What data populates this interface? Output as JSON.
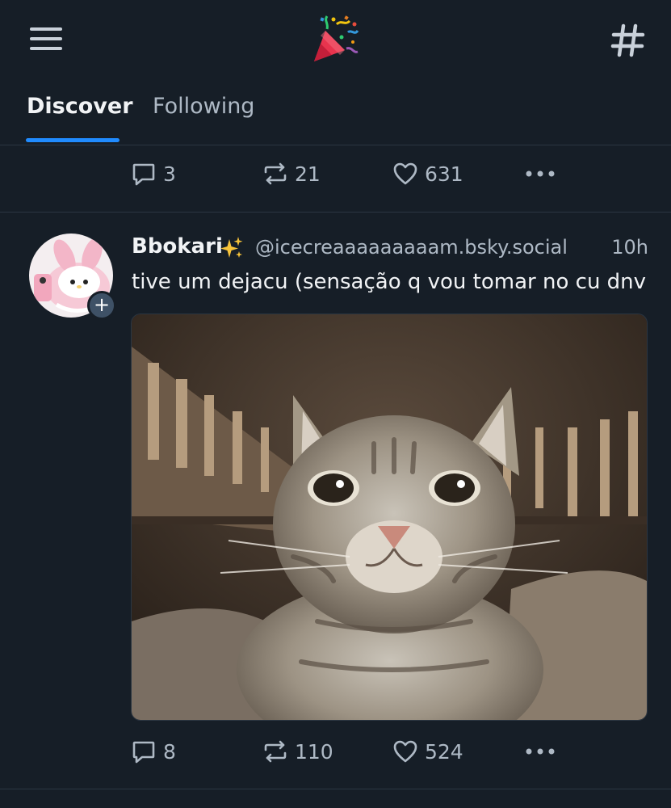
{
  "header": {
    "menu_icon": "hamburger-menu-icon",
    "logo_icon": "party-popper-emoji",
    "feeds_icon": "hashtag-icon"
  },
  "tabs": [
    {
      "label": "Discover",
      "active": true
    },
    {
      "label": "Following",
      "active": false
    }
  ],
  "colors": {
    "background": "#161e27",
    "accent": "#208bfe",
    "muted_text": "#aeb9c5",
    "divider": "#2b3642"
  },
  "previous_post": {
    "replies": "3",
    "reposts": "21",
    "likes": "631"
  },
  "post": {
    "author_name": "Bbokari",
    "author_emoji": "sparkles-emoji",
    "handle": "@icecreaaaaaaaaam.bsky.social",
    "time": "10h",
    "text": "tive um dejacu (sensação q vou tomar no cu dnv",
    "follow_button": "+",
    "image_subject": "tabby cat close-up",
    "replies": "8",
    "reposts": "110",
    "likes": "524"
  }
}
